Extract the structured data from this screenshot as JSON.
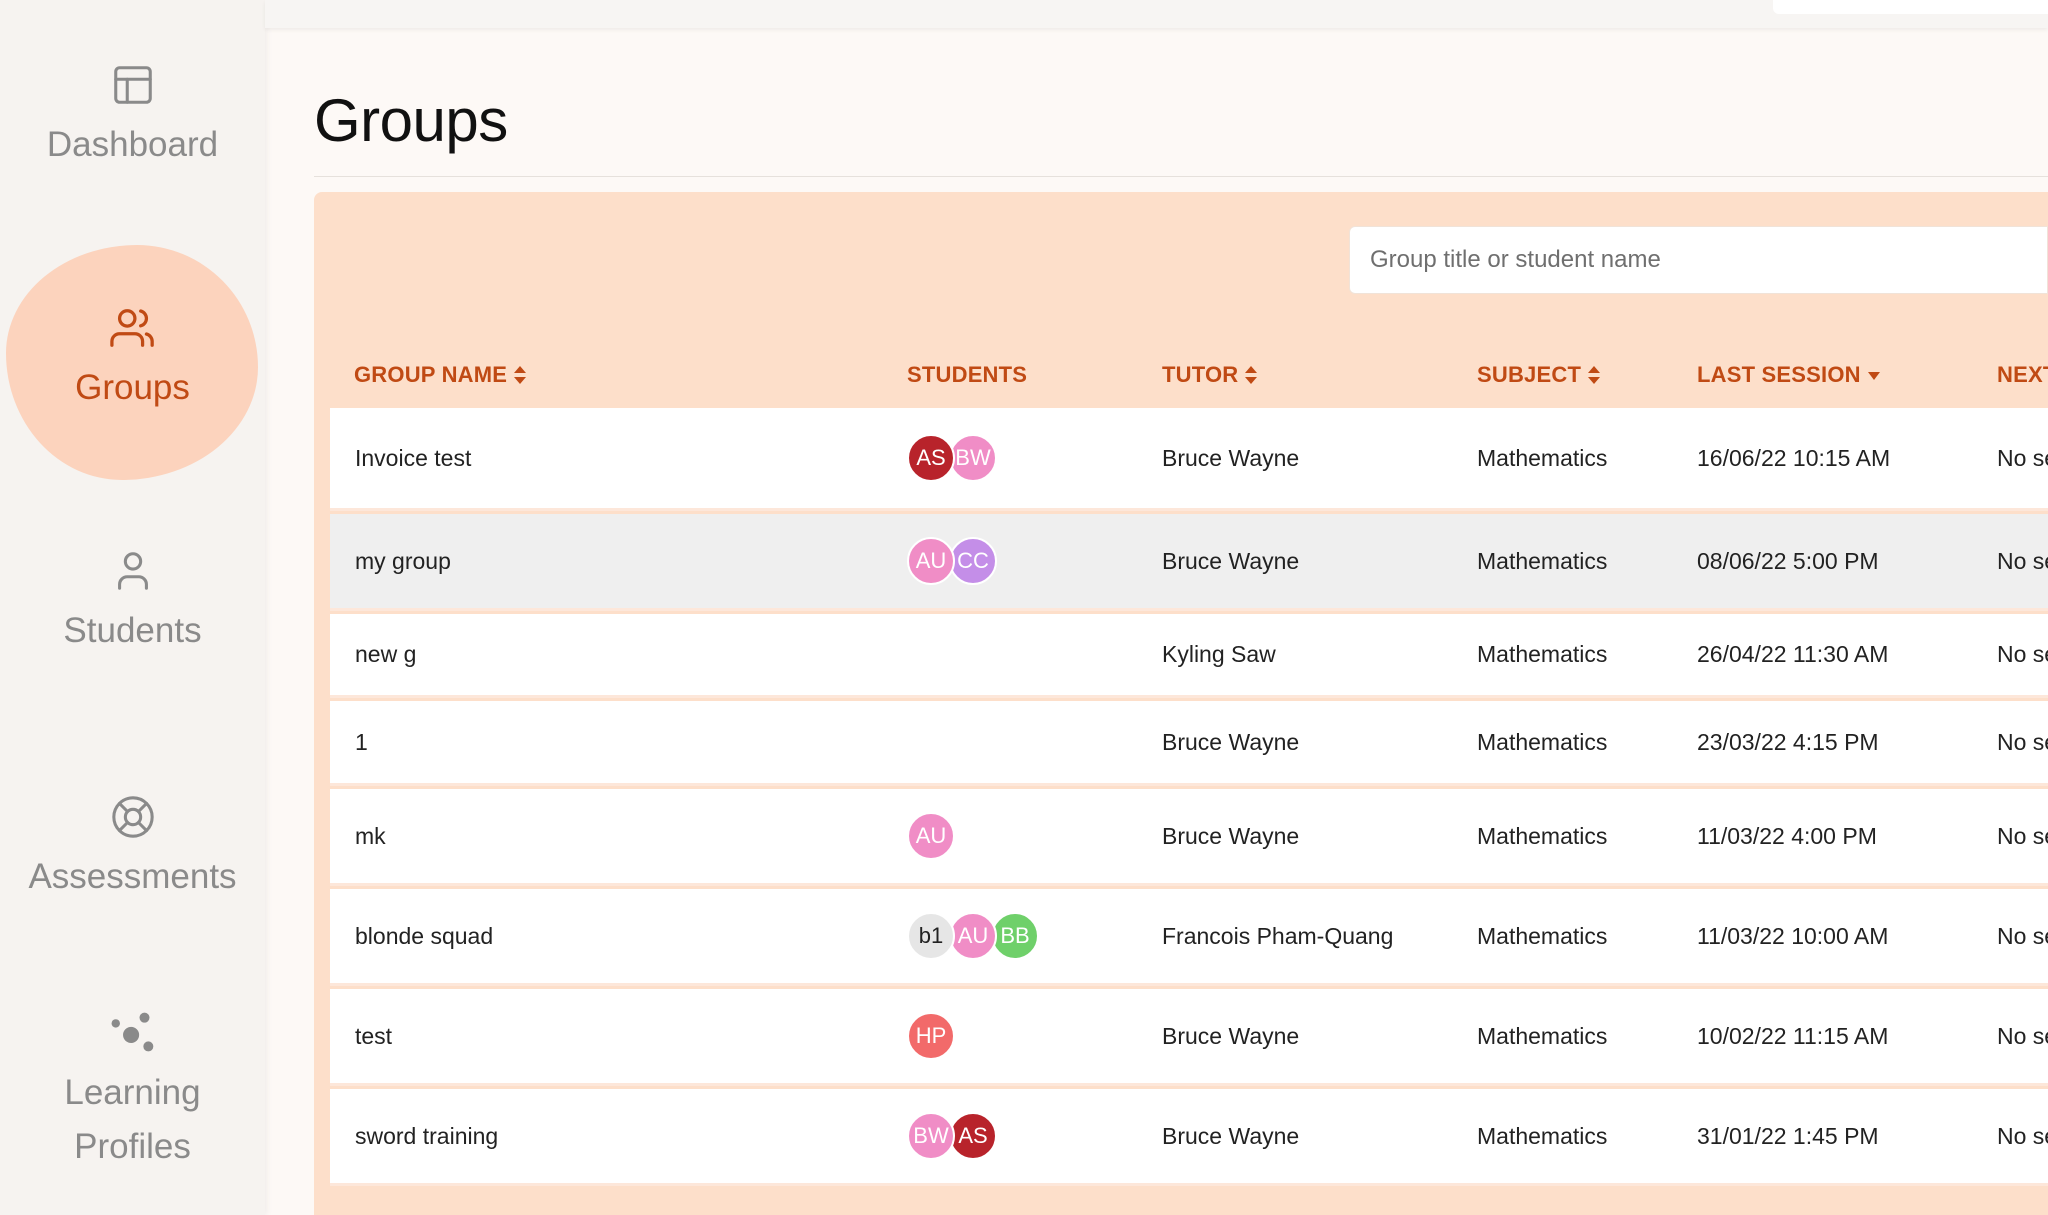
{
  "sidebar": {
    "items": [
      {
        "label": "Dashboard",
        "icon": "layout-icon",
        "active": false
      },
      {
        "label": "Groups",
        "icon": "users-icon",
        "active": true
      },
      {
        "label": "Students",
        "icon": "user-icon",
        "active": false
      },
      {
        "label": "Assessments",
        "icon": "lifebuoy-icon",
        "active": false
      },
      {
        "label": "Learning Profiles",
        "label_line1": "Learning",
        "label_line2": "Profiles",
        "icon": "dots-cluster-icon",
        "active": false
      }
    ]
  },
  "page": {
    "title": "Groups"
  },
  "search": {
    "placeholder": "Group title or student name"
  },
  "table": {
    "columns": [
      {
        "label": "GROUP NAME",
        "sort": "both"
      },
      {
        "label": "STUDENTS",
        "sort": "none"
      },
      {
        "label": "TUTOR",
        "sort": "both"
      },
      {
        "label": "SUBJECT",
        "sort": "both"
      },
      {
        "label": "LAST SESSION",
        "sort": "desc"
      },
      {
        "label": "NEXT",
        "sort": "none"
      }
    ],
    "rows": [
      {
        "name": "Invoice test",
        "students": [
          {
            "initials": "AS",
            "color": "#b8232b"
          },
          {
            "initials": "BW",
            "color": "#f08dc6"
          }
        ],
        "tutor": "Bruce Wayne",
        "subject": "Mathematics",
        "last_session": "16/06/22 10:15 AM",
        "next": "No se"
      },
      {
        "name": "my group",
        "students": [
          {
            "initials": "AU",
            "color": "#f08dc6"
          },
          {
            "initials": "CC",
            "color": "#c48ee8"
          }
        ],
        "tutor": "Bruce Wayne",
        "subject": "Mathematics",
        "last_session": "08/06/22 5:00 PM",
        "next": "No se"
      },
      {
        "name": "new g",
        "students": [],
        "tutor": "Kyling Saw",
        "subject": "Mathematics",
        "last_session": "26/04/22 11:30 AM",
        "next": "No se"
      },
      {
        "name": "1",
        "students": [],
        "tutor": "Bruce Wayne",
        "subject": "Mathematics",
        "last_session": "23/03/22 4:15 PM",
        "next": "No se"
      },
      {
        "name": "mk",
        "students": [
          {
            "initials": "AU",
            "color": "#f08dc6"
          }
        ],
        "tutor": "Bruce Wayne",
        "subject": "Mathematics",
        "last_session": "11/03/22 4:00 PM",
        "next": "No se"
      },
      {
        "name": "blonde squad",
        "students": [
          {
            "initials": "b1",
            "color": "#e6e6e6",
            "text_color": "#222222"
          },
          {
            "initials": "AU",
            "color": "#f08dc6"
          },
          {
            "initials": "BB",
            "color": "#6fd06a"
          }
        ],
        "tutor": "Francois Pham-Quang",
        "subject": "Mathematics",
        "last_session": "11/03/22 10:00 AM",
        "next": "No se"
      },
      {
        "name": "test",
        "students": [
          {
            "initials": "HP",
            "color": "#f26a6a"
          }
        ],
        "tutor": "Bruce Wayne",
        "subject": "Mathematics",
        "last_session": "10/02/22 11:15 AM",
        "next": "No se"
      },
      {
        "name": "sword training",
        "students": [
          {
            "initials": "BW",
            "color": "#f08dc6"
          },
          {
            "initials": "AS",
            "color": "#b8232b"
          }
        ],
        "tutor": "Bruce Wayne",
        "subject": "Mathematics",
        "last_session": "31/01/22 1:45 PM",
        "next": "No se"
      }
    ]
  },
  "colors": {
    "accent": "#c04a14",
    "panel": "#fddfca",
    "active_blob": "#fcd3bd"
  }
}
